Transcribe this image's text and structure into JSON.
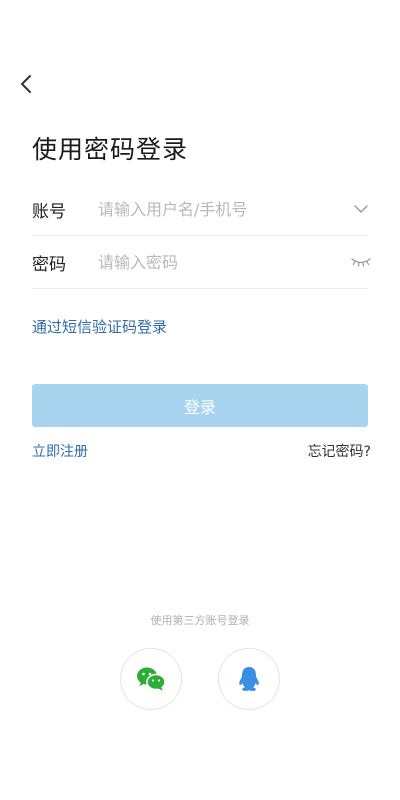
{
  "header": {
    "back_icon": "chevron-left-icon",
    "title": "使用密码登录"
  },
  "form": {
    "account": {
      "label": "账号",
      "placeholder": "请输入用户名/手机号",
      "value": "",
      "icon": "chevron-down-icon"
    },
    "password": {
      "label": "密码",
      "placeholder": "请输入密码",
      "value": "",
      "icon": "eye-closed-icon"
    }
  },
  "links": {
    "sms_login": "通过短信验证码登录",
    "register": "立即注册",
    "forgot_password": "忘记密码?"
  },
  "login_button": {
    "label": "登录",
    "color": "#a8d4f0"
  },
  "third_party": {
    "label": "使用第三方账号登录",
    "providers": [
      {
        "name": "wechat",
        "icon": "wechat-icon",
        "color": "#2aae33"
      },
      {
        "name": "qq",
        "icon": "qq-icon",
        "color": "#3a8ee6"
      }
    ]
  },
  "colors": {
    "link": "#2f6cab",
    "placeholder": "#b8b8b8",
    "divider": "#ececec"
  }
}
